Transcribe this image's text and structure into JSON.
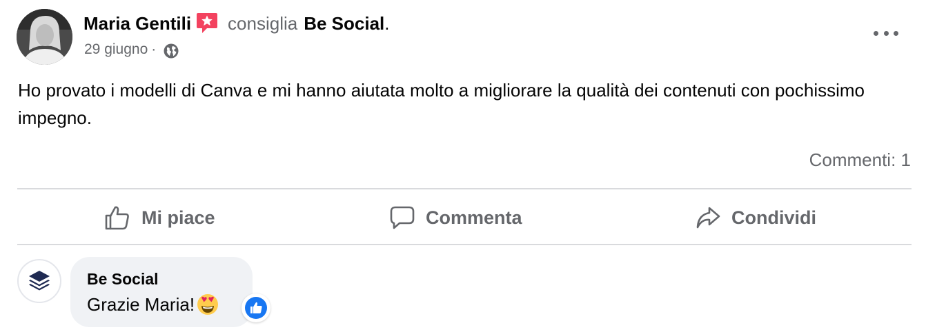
{
  "post": {
    "author": "Maria Gentili",
    "verb": "consiglia",
    "page": "Be Social",
    "period": ".",
    "date": "29 giugno",
    "separator": "·",
    "audience_icon": "globe-icon",
    "recommend_icon": "recommend-star-icon",
    "text": "Ho provato i modelli di Canva e mi hanno aiutata molto a migliorare la qualità dei contenuti con pochissimo impegno.",
    "comments_count": "Commenti: 1"
  },
  "actions": {
    "like": "Mi piace",
    "comment": "Commenta",
    "share": "Condividi"
  },
  "comment": {
    "author": "Be Social",
    "text": "Grazie Maria!",
    "emoji_icon": "heart-eyes-emoji",
    "reaction_icon": "like-reaction-icon"
  },
  "colors": {
    "text_primary": "#050505",
    "text_secondary": "#65676b",
    "recommend_red": "#f3425f",
    "like_blue": "#1877f2",
    "bubble_bg": "#f0f2f5",
    "divider": "#d9dadd",
    "brand_navy": "#1f2a52"
  }
}
